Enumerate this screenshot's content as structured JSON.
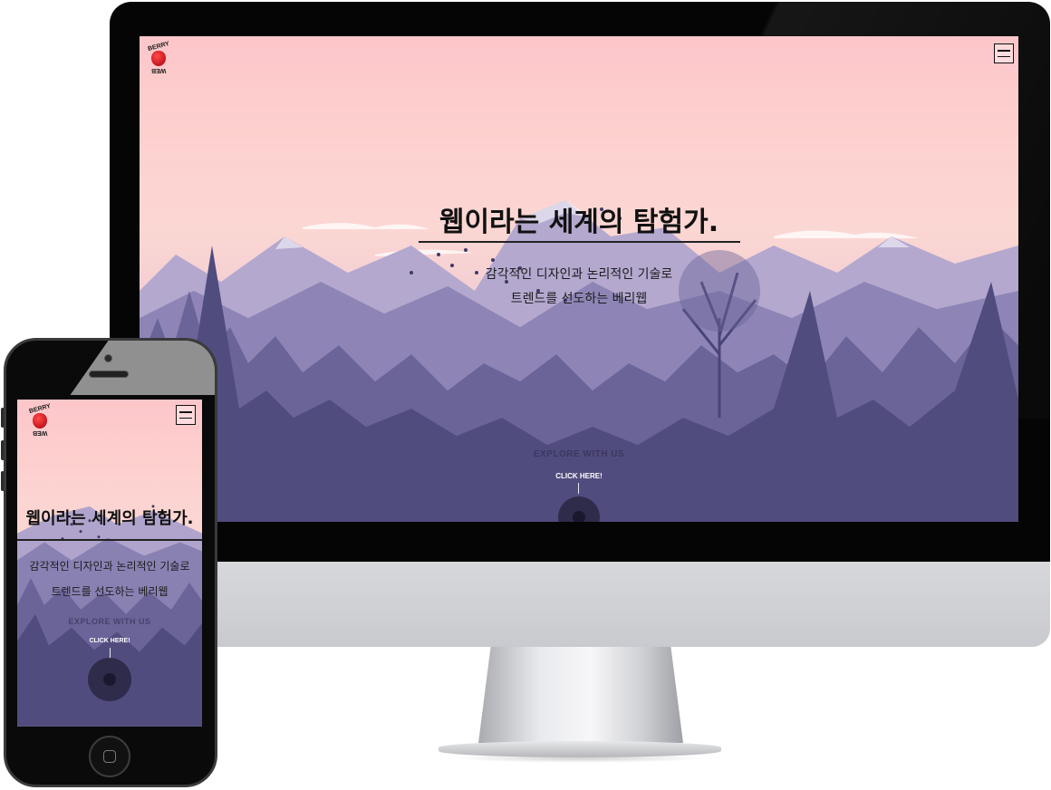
{
  "brand": {
    "logo_top": "BERRY",
    "logo_bottom": "WEB"
  },
  "hero": {
    "headline": "웹이라는 세계의 탐험가.",
    "subtitle_line1": "감각적인 디자인과 논리적인 기술로",
    "subtitle_line2": "트렌드를 선도하는 베리웹",
    "explore_text": "EXPLORE WITH US",
    "cta_label": "CLICK HERE!"
  },
  "icons": {
    "menu": "hamburger-menu-icon",
    "logo": "strawberry-logo-icon",
    "cta": "circle-play-icon"
  },
  "colors": {
    "sky_top": "#fdc6ca",
    "mountain": "#8b82b3",
    "forest": "#4d4a77",
    "logo_red": "#c4141b"
  }
}
